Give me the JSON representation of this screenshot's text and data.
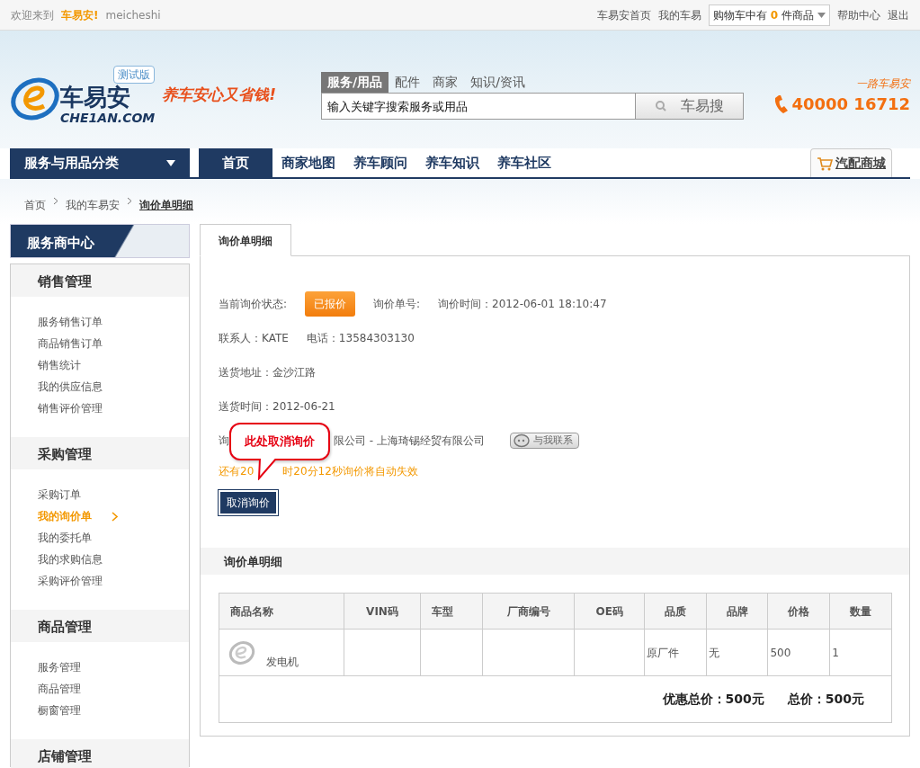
{
  "top_bar": {
    "welcome": "欢迎来到",
    "brand": "车易安!",
    "user": "meicheshi",
    "links": [
      "车易安首页",
      "我的车易"
    ],
    "cart": {
      "prefix": "购物车中有",
      "count": "0",
      "suffix": "件商品"
    },
    "links_right": [
      "帮助中心",
      "退出"
    ]
  },
  "header": {
    "logo": {
      "badge": "测试版",
      "name": "车易安",
      "domain": "CHE1AN.COM",
      "slogan": "养车安心又省钱!"
    },
    "search_tabs": [
      {
        "label": "服务/用品",
        "selected": true
      },
      {
        "label": "配件",
        "selected": false
      },
      {
        "label": "商家",
        "selected": false
      },
      {
        "label": "知识/资讯",
        "selected": false
      }
    ],
    "search": {
      "placeholder": "输入关键字搜索服务或用品",
      "button": "车易搜"
    },
    "hotline": {
      "caption": "一路车易安",
      "number": "40000 16712"
    }
  },
  "nav": {
    "category": "服务与用品分类",
    "items": [
      {
        "label": "首页",
        "selected": true
      },
      {
        "label": "商家地图",
        "selected": false
      },
      {
        "label": "养车顾问",
        "selected": false
      },
      {
        "label": "养车知识",
        "selected": false
      },
      {
        "label": "养车社区",
        "selected": false
      }
    ],
    "mall": "汽配商城"
  },
  "breadcrumb": [
    "首页",
    "我的车易安",
    "询价单明细"
  ],
  "sidebar": {
    "title": "服务商中心",
    "groups": [
      {
        "title": "销售管理",
        "items": [
          {
            "label": "服务销售订单",
            "selected": false
          },
          {
            "label": "商品销售订单",
            "selected": false
          },
          {
            "label": "销售统计",
            "selected": false
          },
          {
            "label": "我的供应信息",
            "selected": false
          },
          {
            "label": "销售评价管理",
            "selected": false
          }
        ]
      },
      {
        "title": "采购管理",
        "items": [
          {
            "label": "采购订单",
            "selected": false
          },
          {
            "label": "我的询价单",
            "selected": true
          },
          {
            "label": "我的委托单",
            "selected": false
          },
          {
            "label": "我的求购信息",
            "selected": false
          },
          {
            "label": "采购评价管理",
            "selected": false
          }
        ]
      },
      {
        "title": "商品管理",
        "items": [
          {
            "label": "服务管理",
            "selected": false
          },
          {
            "label": "商品管理",
            "selected": false
          },
          {
            "label": "橱窗管理",
            "selected": false
          }
        ]
      },
      {
        "title": "店铺管理"
      }
    ]
  },
  "main": {
    "tab": "询价单明细",
    "status_label": "当前询价状态:",
    "status": "已报价",
    "order_no_label": "询价单号:",
    "time": "询价时间：2012-06-01 18:10:47",
    "contact": "联系人：KATE",
    "phone": "电话：13584303130",
    "address": "送货地址：金沙江路",
    "delivery": "送货时间：2012-06-21",
    "supplier_parts": [
      "询",
      "限公司 - 上海琦锡经贸有限公司"
    ],
    "contact_button": "与我联系",
    "warning_parts": [
      "还有20",
      "时20分12秒询价将自动失效"
    ],
    "cancel_button": "取消询价",
    "callout": "此处取消询价",
    "section_title": "询价单明细",
    "table": {
      "columns": [
        "商品名称",
        "VIN码",
        "车型",
        "厂商编号",
        "OE码",
        "品质",
        "品牌",
        "价格",
        "数量"
      ],
      "rows": [
        {
          "cells": [
            "发电机",
            "",
            "",
            "",
            "",
            "原厂件",
            "无",
            "500",
            "1"
          ]
        }
      ],
      "discount_total": "优惠总价：500元",
      "total": "总价：500元"
    }
  }
}
